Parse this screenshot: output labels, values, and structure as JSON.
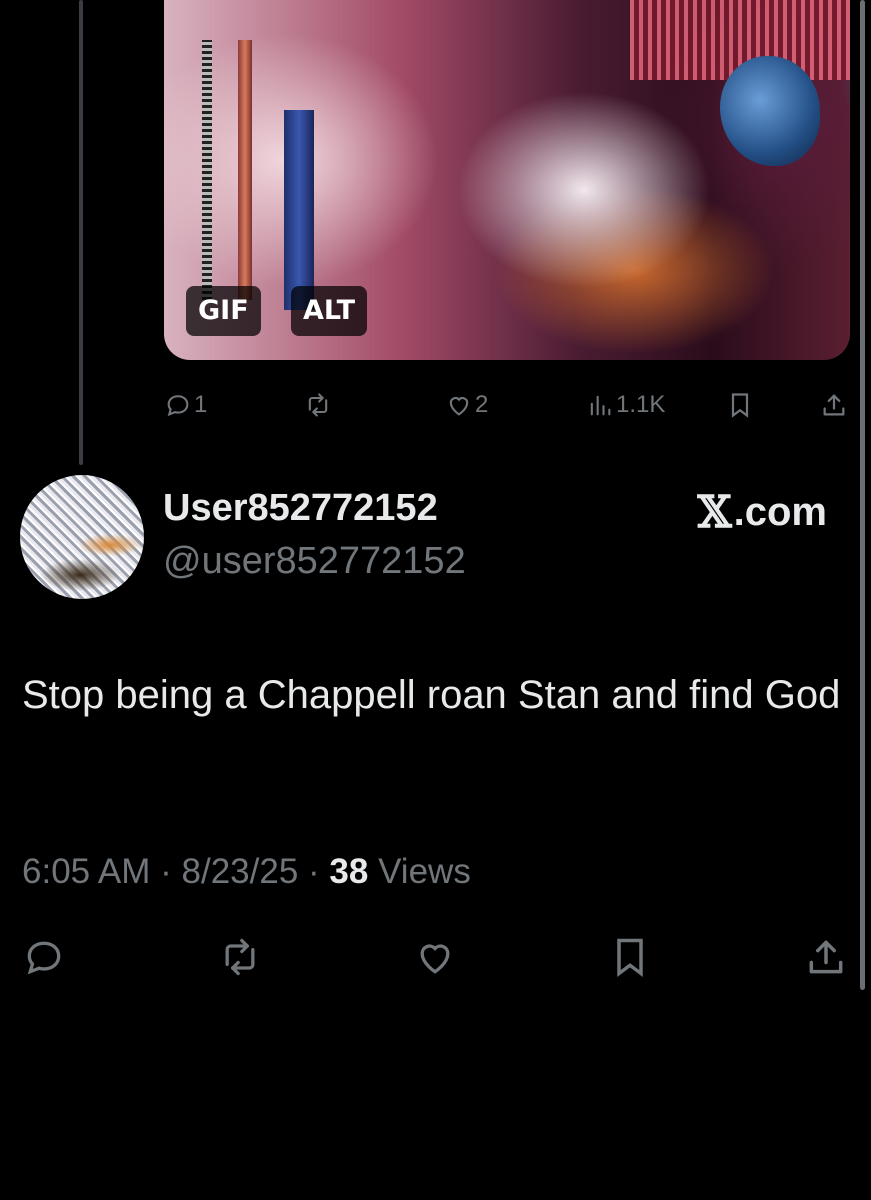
{
  "media": {
    "badges": {
      "gif": "GIF",
      "alt": "ALT"
    }
  },
  "reply_actions": {
    "replies": "1",
    "likes": "2",
    "views": "1.1K"
  },
  "author": {
    "name": "User852772152",
    "handle": "@user852772152"
  },
  "watermark": {
    "x": "𝕏",
    "domain": ".com"
  },
  "post": {
    "text": "Stop being a Chappell roan Stan and find God",
    "time": "6:05 AM",
    "sep1": " · ",
    "date": "8/23/25",
    "sep2": " · ",
    "views_count": "38",
    "views_label": " Views"
  },
  "colors": {
    "background": "#000000",
    "text_primary": "#e7e9ea",
    "text_secondary": "#71767b"
  },
  "icons": {
    "reply": "reply-icon",
    "repost": "repost-icon",
    "like": "like-icon",
    "views": "views-icon",
    "bookmark": "bookmark-icon",
    "share": "share-icon"
  }
}
